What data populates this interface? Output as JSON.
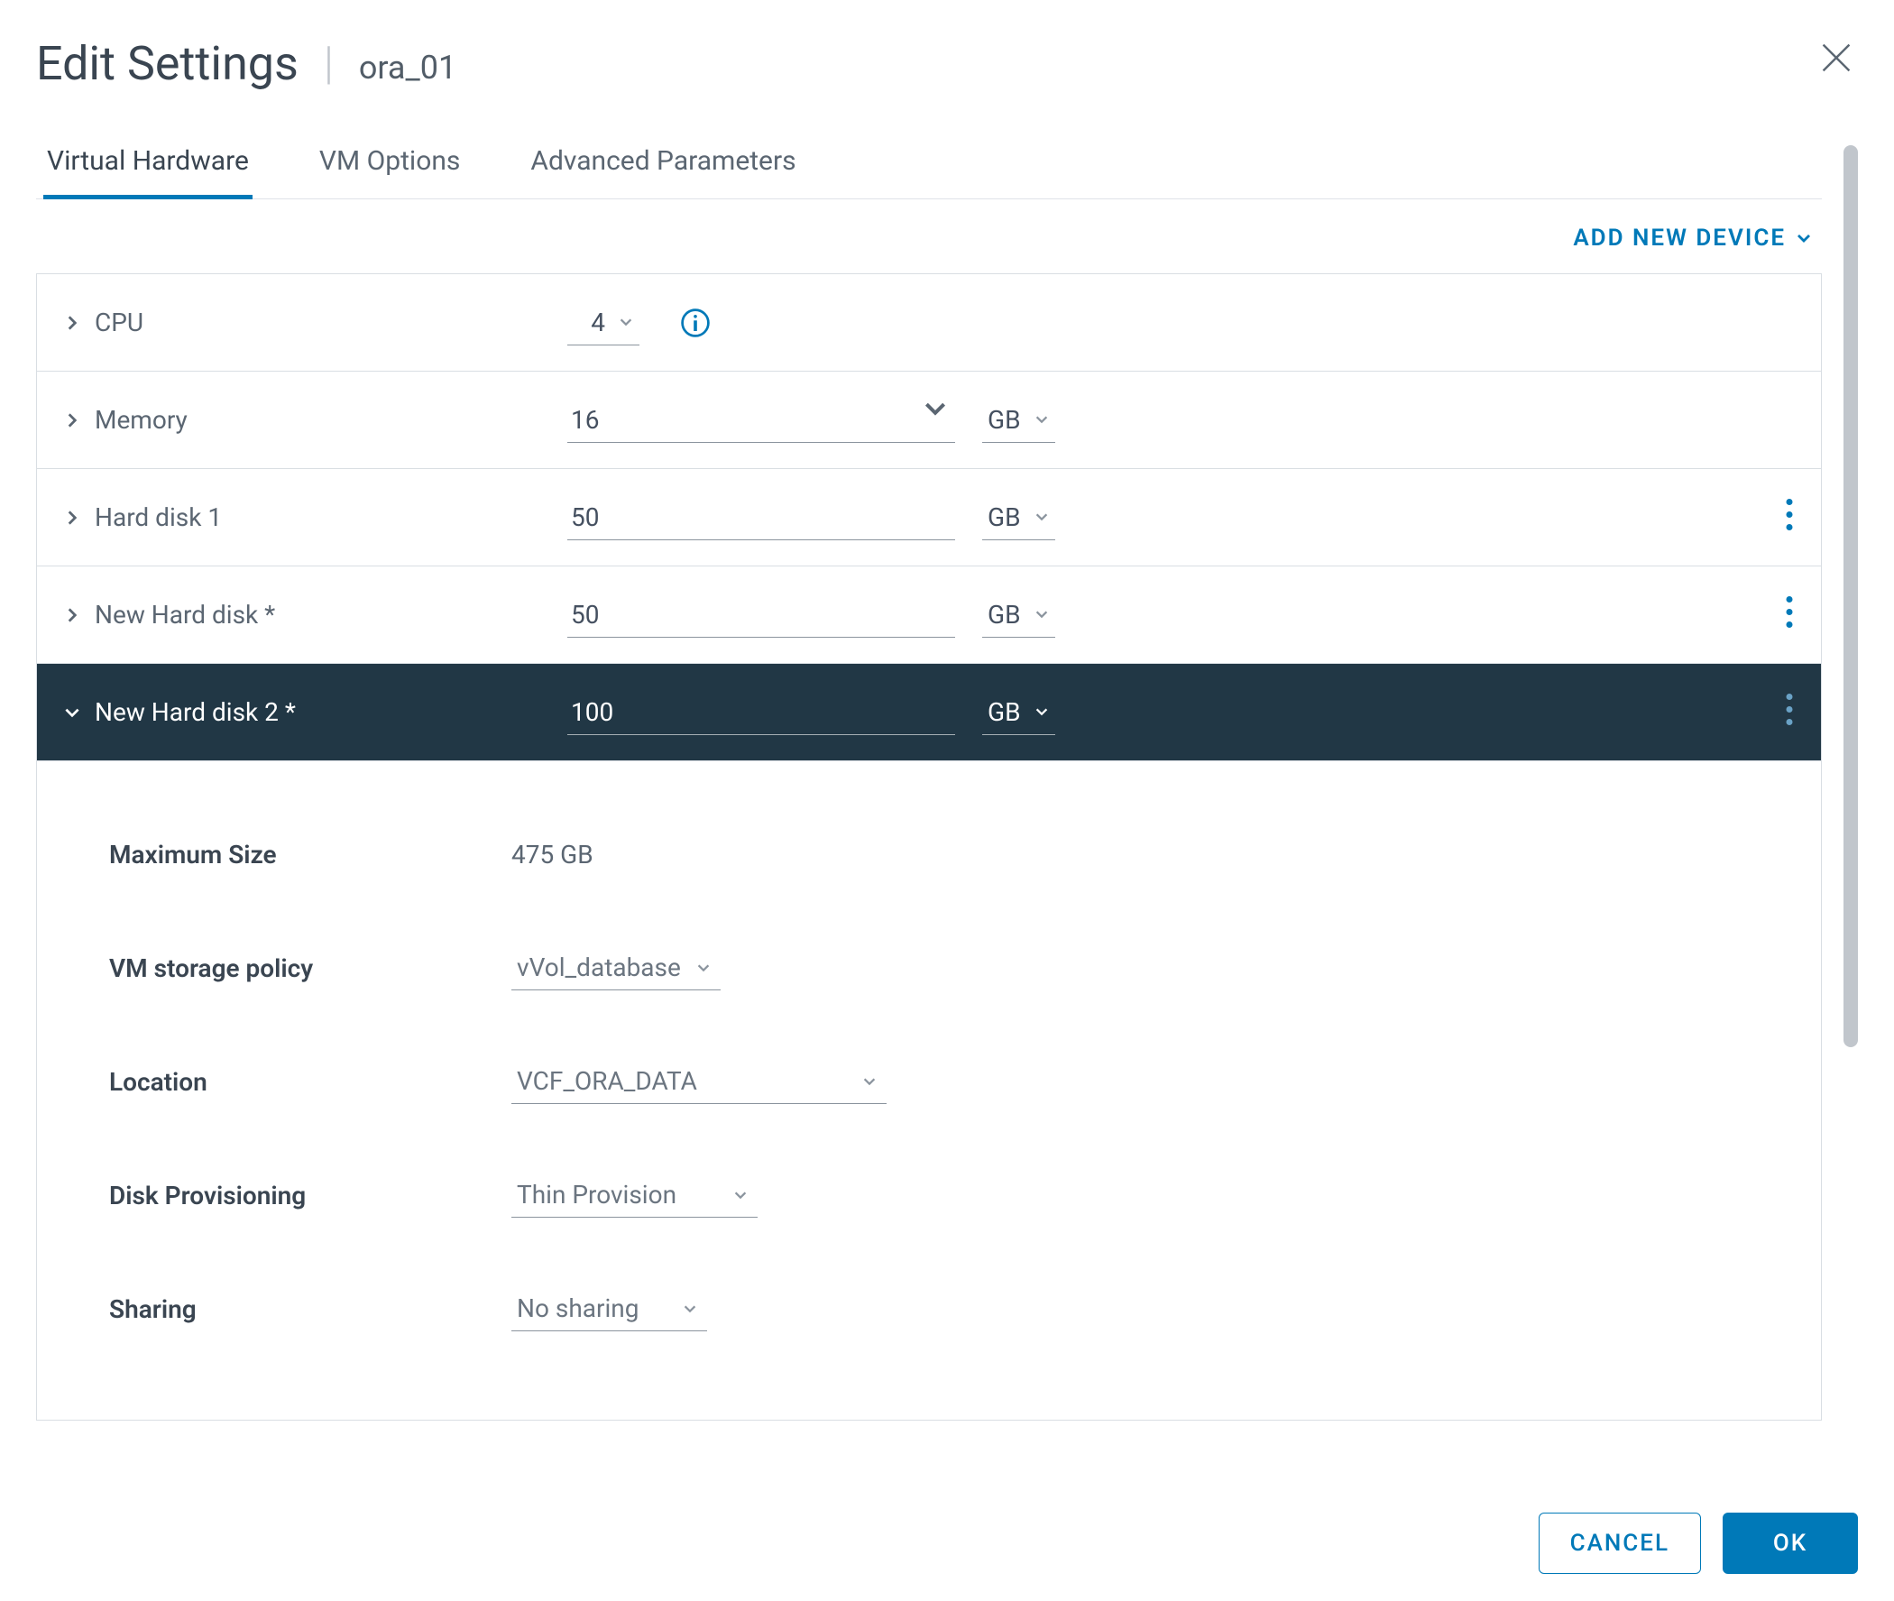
{
  "dialog": {
    "title": "Edit Settings",
    "entity_name": "ora_01",
    "tabs": [
      {
        "label": "Virtual Hardware",
        "active": true
      },
      {
        "label": "VM Options",
        "active": false
      },
      {
        "label": "Advanced Parameters",
        "active": false
      }
    ],
    "add_device_label": "ADD NEW DEVICE"
  },
  "hardware": {
    "cpu": {
      "label": "CPU",
      "value": "4"
    },
    "memory": {
      "label": "Memory",
      "value": "16",
      "unit": "GB"
    },
    "hard_disk_1": {
      "label": "Hard disk 1",
      "value": "50",
      "unit": "GB"
    },
    "new_hard_disk": {
      "label": "New Hard disk *",
      "value": "50",
      "unit": "GB"
    },
    "new_hard_disk_2": {
      "label": "New Hard disk 2 *",
      "value": "100",
      "unit": "GB",
      "details": {
        "max_size_label": "Maximum Size",
        "max_size_value": "475 GB",
        "storage_policy_label": "VM storage policy",
        "storage_policy_value": "vVol_database",
        "location_label": "Location",
        "location_value": "VCF_ORA_DATA",
        "provisioning_label": "Disk Provisioning",
        "provisioning_value": "Thin Provision",
        "sharing_label": "Sharing",
        "sharing_value": "No sharing"
      }
    }
  },
  "footer": {
    "cancel_label": "CANCEL",
    "ok_label": "OK"
  }
}
